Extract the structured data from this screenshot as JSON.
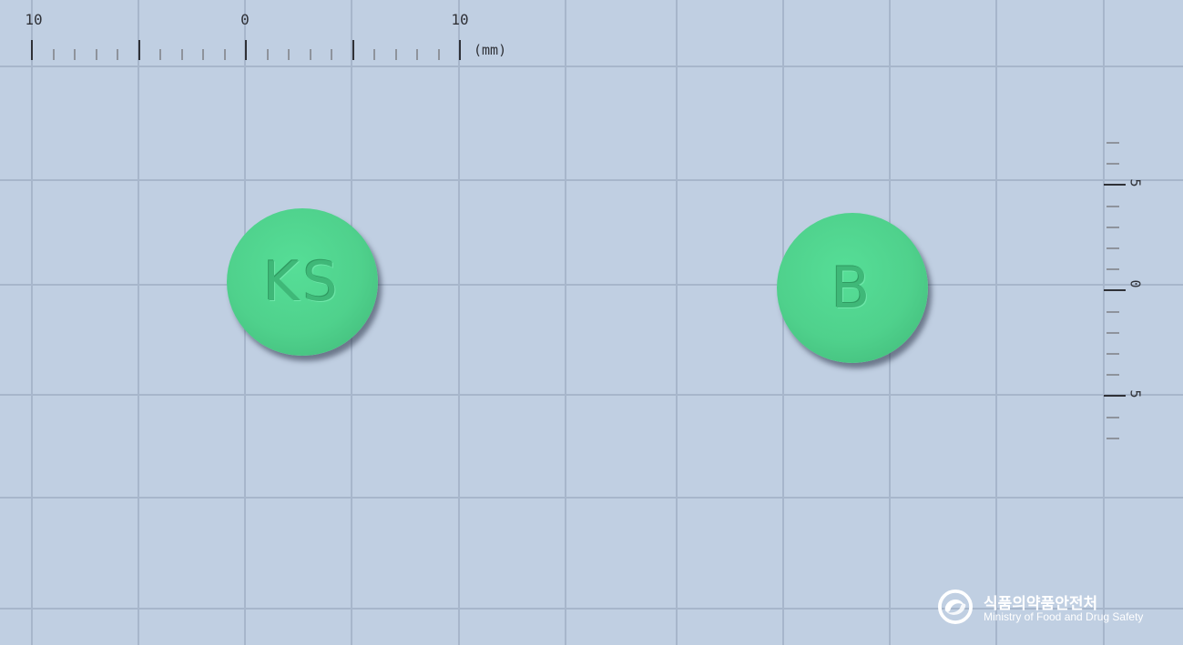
{
  "ruler": {
    "top_labels": [
      "10",
      "0",
      "10"
    ],
    "unit": "(mm)",
    "side_labels": [
      "5",
      "0",
      "5"
    ]
  },
  "pills": [
    {
      "name": "pill-front",
      "imprint": "KS",
      "color": "#4fd18c"
    },
    {
      "name": "pill-back",
      "imprint": "B",
      "color": "#4fd18c"
    }
  ],
  "logo": {
    "korean": "식품의약품안전처",
    "english": "Ministry of Food and Drug Safety",
    "icon": "mfds-logo-icon"
  },
  "colors": {
    "background": "#c0cfe2",
    "grid": "#a7b6cb",
    "pill": "#4fd18c"
  }
}
